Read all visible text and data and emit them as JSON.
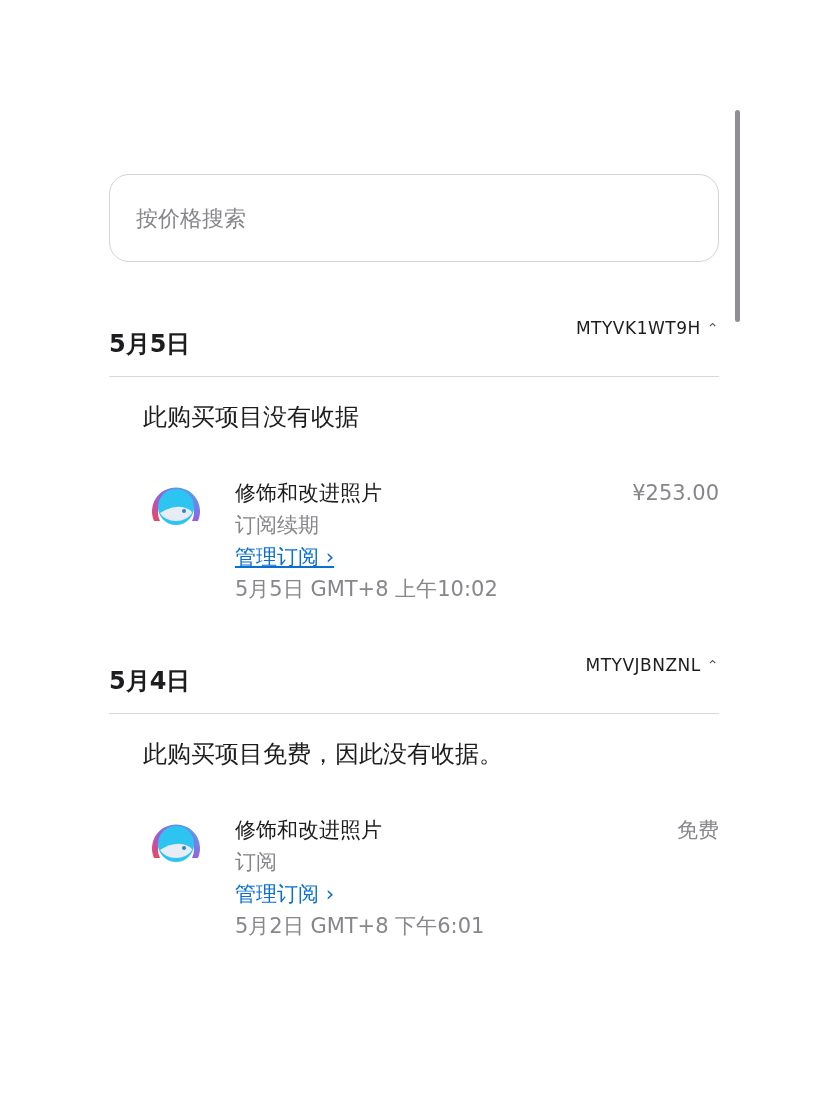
{
  "search": {
    "placeholder": "按价格搜索"
  },
  "sections": [
    {
      "date": "5月5日",
      "order_id": "MTYVK1WT9H",
      "chevron": "⌃",
      "expanded": true,
      "note": "此购买项目没有收据",
      "items": [
        {
          "title": "修饰和改进照片",
          "type": "订阅续期",
          "price": "¥253.00",
          "link": "管理订阅 ›",
          "hovered": true,
          "datetime": "5月5日 GMT+8 上午10:02"
        }
      ]
    },
    {
      "date": "5月4日",
      "order_id": "MTYVJBNZNL",
      "chevron": "⌃",
      "expanded": true,
      "note": "此购买项目免费，因此没有收据。",
      "items": [
        {
          "title": "修饰和改进照片",
          "type": "订阅",
          "price": "免费",
          "link": "管理订阅 ›",
          "hovered": false,
          "datetime": "5月2日 GMT+8 下午6:01"
        }
      ]
    }
  ]
}
